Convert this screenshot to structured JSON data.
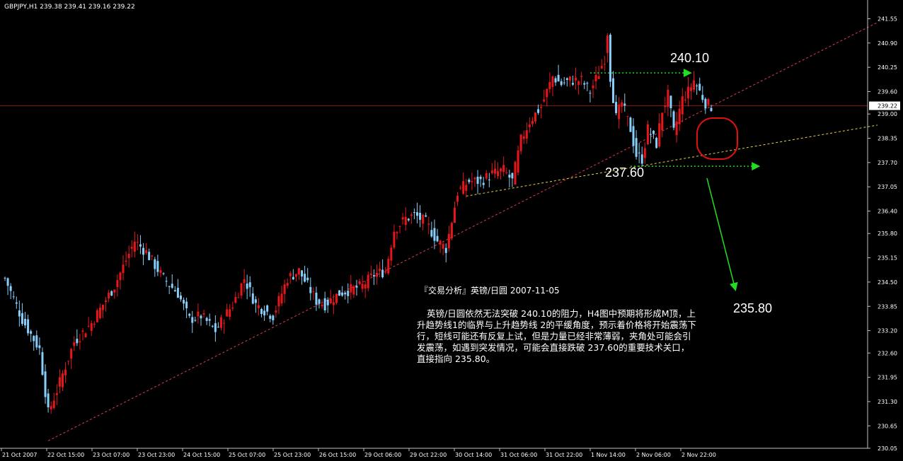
{
  "header": {
    "symbol_line": "GBPJPY,H1  239.38 239.41 239.16 239.22"
  },
  "annotations": {
    "resistance_label": "240.10",
    "support_label": "237.60",
    "target_label": "235.80",
    "note_title": "『交易分析』英镑/日圆 2007-11-05",
    "note_body": "英镑/日圆依然无法突破 240.10的阻力，H4图中预期将形成M顶，上升趋势线1的临界与上升趋势线 2的平缓角度，预示着价格将开始震荡下行，短线可能还有反复上试，但是力量已经非常薄弱，夹角处可能会引发震荡，如遇到突发情况，可能会直接跌破 237.60的重要技术关口，直接指向 235.80。"
  },
  "colors": {
    "background": "#000000",
    "bull_candle": "#e8161b",
    "bear_candle": "#87cefa",
    "axis": "#c0c0c0",
    "trendline_1": "#e33b4f",
    "trendline_2": "#e6d24a",
    "level_lines": "#22dd22",
    "current_price_line": "#8b1a1a",
    "circle": "#e01010",
    "target_arrow": "#22dd22"
  },
  "chart_data": {
    "type": "candlestick",
    "symbol": "GBPJPY",
    "timeframe": "H1",
    "ohlc_last": {
      "open": 239.38,
      "high": 239.41,
      "low": 239.16,
      "close": 239.22
    },
    "current_price": 239.22,
    "ylim": [
      230.05,
      241.9
    ],
    "y_ticks": [
      "241.55",
      "240.90",
      "240.25",
      "239.60",
      "239.00",
      "238.35",
      "237.70",
      "237.05",
      "236.40",
      "235.80",
      "235.15",
      "234.50",
      "233.85",
      "233.20",
      "232.60",
      "231.95",
      "231.30",
      "230.65",
      "230.05"
    ],
    "x_ticks": [
      "21 Oct 2007",
      "22 Oct 15:00",
      "23 Oct 07:00",
      "23 Oct 23:00",
      "24 Oct 15:00",
      "25 Oct 07:00",
      "25 Oct 23:00",
      "26 Oct 15:00",
      "29 Oct 06:00",
      "29 Oct 22:00",
      "30 Oct 14:00",
      "31 Oct 06:00",
      "31 Oct 22:00",
      "1 Nov 14:00",
      "2 Nov 06:00",
      "2 Nov 22:00"
    ],
    "key_closes": [
      {
        "i": 0,
        "c": 234.6
      },
      {
        "i": 6,
        "c": 233.5
      },
      {
        "i": 12,
        "c": 232.7
      },
      {
        "i": 15,
        "c": 231.0
      },
      {
        "i": 18,
        "c": 231.6
      },
      {
        "i": 24,
        "c": 232.9
      },
      {
        "i": 30,
        "c": 233.4
      },
      {
        "i": 38,
        "c": 234.4
      },
      {
        "i": 45,
        "c": 235.6
      },
      {
        "i": 49,
        "c": 235.3
      },
      {
        "i": 55,
        "c": 234.6
      },
      {
        "i": 60,
        "c": 234.2
      },
      {
        "i": 64,
        "c": 233.5
      },
      {
        "i": 68,
        "c": 233.6
      },
      {
        "i": 73,
        "c": 233.2
      },
      {
        "i": 79,
        "c": 233.9
      },
      {
        "i": 83,
        "c": 234.6
      },
      {
        "i": 87,
        "c": 233.9
      },
      {
        "i": 93,
        "c": 233.6
      },
      {
        "i": 98,
        "c": 234.6
      },
      {
        "i": 102,
        "c": 234.8
      },
      {
        "i": 105,
        "c": 234.4
      },
      {
        "i": 108,
        "c": 234.0
      },
      {
        "i": 111,
        "c": 233.9
      },
      {
        "i": 116,
        "c": 234.2
      },
      {
        "i": 120,
        "c": 234.3
      },
      {
        "i": 124,
        "c": 234.4
      },
      {
        "i": 128,
        "c": 234.7
      },
      {
        "i": 132,
        "c": 234.8
      },
      {
        "i": 135,
        "c": 235.9
      },
      {
        "i": 139,
        "c": 236.2
      },
      {
        "i": 142,
        "c": 236.3
      },
      {
        "i": 146,
        "c": 236.1
      },
      {
        "i": 150,
        "c": 235.6
      },
      {
        "i": 153,
        "c": 235.4
      },
      {
        "i": 157,
        "c": 236.9
      },
      {
        "i": 161,
        "c": 237.2
      },
      {
        "i": 165,
        "c": 237.2
      },
      {
        "i": 169,
        "c": 237.4
      },
      {
        "i": 173,
        "c": 237.5
      },
      {
        "i": 176,
        "c": 237.2
      },
      {
        "i": 179,
        "c": 238.3
      },
      {
        "i": 182,
        "c": 238.8
      },
      {
        "i": 186,
        "c": 239.2
      },
      {
        "i": 190,
        "c": 240.0
      },
      {
        "i": 193,
        "c": 239.8
      },
      {
        "i": 196,
        "c": 239.9
      },
      {
        "i": 200,
        "c": 239.9
      },
      {
        "i": 203,
        "c": 239.6
      },
      {
        "i": 206,
        "c": 240.1
      },
      {
        "i": 208,
        "c": 240.5
      },
      {
        "i": 209,
        "c": 241.2
      },
      {
        "i": 210,
        "c": 240.0
      },
      {
        "i": 212,
        "c": 238.9
      },
      {
        "i": 214,
        "c": 239.3
      },
      {
        "i": 217,
        "c": 238.6
      },
      {
        "i": 219,
        "c": 237.9
      },
      {
        "i": 221,
        "c": 237.8
      },
      {
        "i": 223,
        "c": 238.6
      },
      {
        "i": 226,
        "c": 238.2
      },
      {
        "i": 228,
        "c": 239.1
      },
      {
        "i": 230,
        "c": 239.5
      },
      {
        "i": 232,
        "c": 238.5
      },
      {
        "i": 235,
        "c": 239.4
      },
      {
        "i": 237,
        "c": 239.6
      },
      {
        "i": 239,
        "c": 239.9
      },
      {
        "i": 241,
        "c": 239.6
      },
      {
        "i": 243,
        "c": 239.3
      },
      {
        "i": 245,
        "c": 239.2
      }
    ],
    "levels": [
      {
        "name": "240.10",
        "value": 240.1,
        "style": "dotted",
        "color": "#22dd22"
      },
      {
        "name": "237.60",
        "value": 237.6,
        "style": "dotted",
        "color": "#22dd22"
      }
    ],
    "trendlines": [
      {
        "from": {
          "i": 15,
          "v": 230.25
        },
        "to": {
          "i": 250,
          "v": 239.4
        }
      },
      {
        "from": {
          "i": 160,
          "v": 236.8
        },
        "to": {
          "i": 250,
          "v": 238.0
        }
      }
    ],
    "target": 235.8
  }
}
